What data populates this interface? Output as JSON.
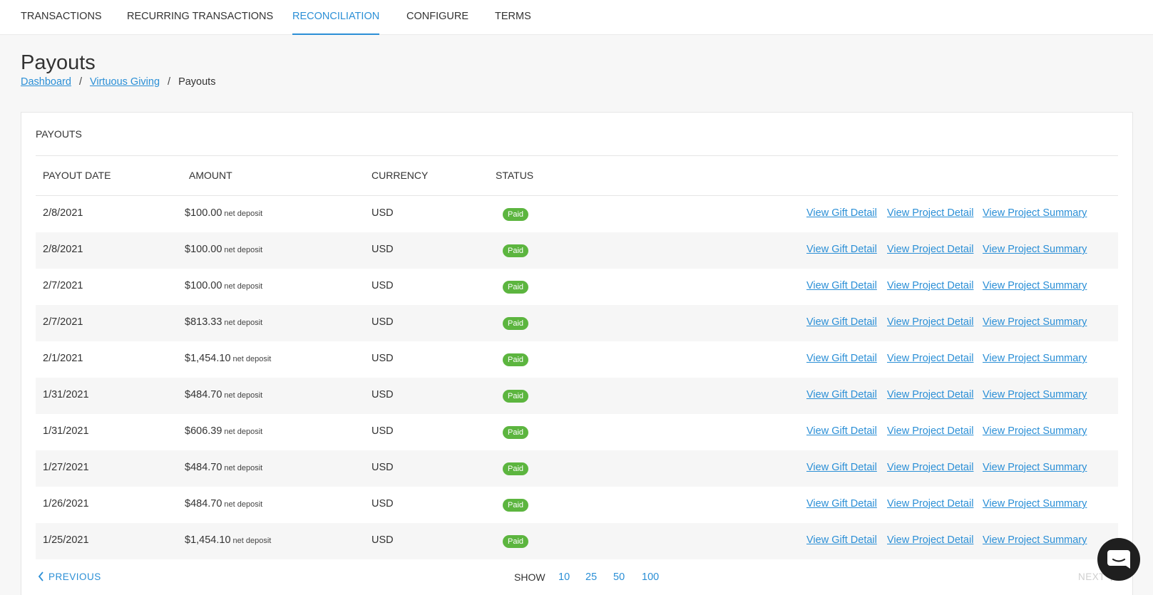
{
  "nav": {
    "tabs": [
      "TRANSACTIONS",
      "RECURRING TRANSACTIONS",
      "RECONCILIATION",
      "CONFIGURE",
      "TERMS"
    ],
    "active": "RECONCILIATION"
  },
  "page": {
    "title": "Payouts",
    "breadcrumb": [
      "Dashboard",
      "Virtuous Giving",
      "Payouts"
    ]
  },
  "card": {
    "title": "PAYOUTS",
    "columns": [
      "PAYOUT DATE",
      "AMOUNT",
      "CURRENCY",
      "STATUS"
    ],
    "rows": [
      {
        "date": "2/8/2021",
        "amount": "$100.00",
        "amount_note": "net deposit",
        "currency": "USD",
        "status": "Paid"
      },
      {
        "date": "2/8/2021",
        "amount": "$100.00",
        "amount_note": "net deposit",
        "currency": "USD",
        "status": "Paid"
      },
      {
        "date": "2/7/2021",
        "amount": "$100.00",
        "amount_note": "net deposit",
        "currency": "USD",
        "status": "Paid"
      },
      {
        "date": "2/7/2021",
        "amount": "$813.33",
        "amount_note": "net deposit",
        "currency": "USD",
        "status": "Paid"
      },
      {
        "date": "2/1/2021",
        "amount": "$1,454.10",
        "amount_note": "net deposit",
        "currency": "USD",
        "status": "Paid"
      },
      {
        "date": "1/31/2021",
        "amount": "$484.70",
        "amount_note": "net deposit",
        "currency": "USD",
        "status": "Paid"
      },
      {
        "date": "1/31/2021",
        "amount": "$606.39",
        "amount_note": "net deposit",
        "currency": "USD",
        "status": "Paid"
      },
      {
        "date": "1/27/2021",
        "amount": "$484.70",
        "amount_note": "net deposit",
        "currency": "USD",
        "status": "Paid"
      },
      {
        "date": "1/26/2021",
        "amount": "$484.70",
        "amount_note": "net deposit",
        "currency": "USD",
        "status": "Paid"
      },
      {
        "date": "1/25/2021",
        "amount": "$1,454.10",
        "amount_note": "net deposit",
        "currency": "USD",
        "status": "Paid"
      }
    ],
    "row_links": [
      "View Gift Detail",
      "View Project Detail",
      "View Project Summary"
    ]
  },
  "pager": {
    "previous": "PREVIOUS",
    "next": "NEXT",
    "show_label": "SHOW",
    "sizes": [
      "10",
      "25",
      "50",
      "100"
    ]
  },
  "colors": {
    "accent": "#2b8fd6",
    "paid_badge": "#5cb53f",
    "chat_button": "#1f1f1f"
  },
  "icons": {
    "previous": "chevron-left-icon",
    "next": "chevron-right-icon",
    "chat": "chat-bubble-icon"
  }
}
